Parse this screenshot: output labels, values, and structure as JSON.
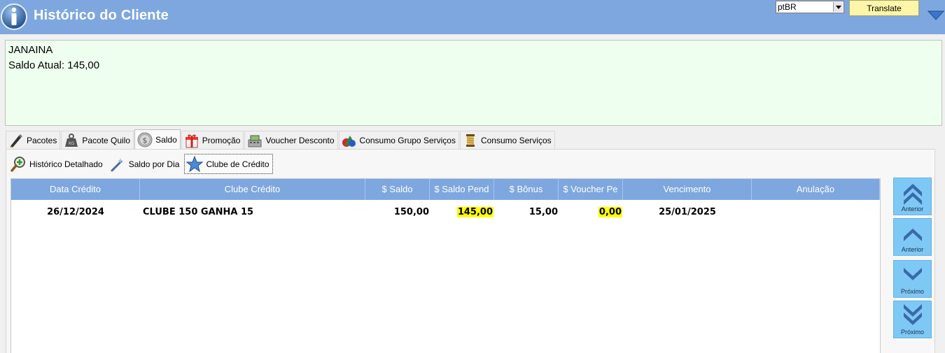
{
  "header": {
    "title": "Histórico do Cliente",
    "language": "ptBR",
    "translate_label": "Translate"
  },
  "client": {
    "name": "JANAINA",
    "balance_line": "Saldo Atual: 145,00"
  },
  "tabs": [
    {
      "label": "Pacotes",
      "icon": "pen-icon"
    },
    {
      "label": "Pacote Quilo",
      "icon": "weight-icon"
    },
    {
      "label": "Saldo",
      "icon": "coin-icon"
    },
    {
      "label": "Promoção",
      "icon": "gift-icon"
    },
    {
      "label": "Voucher Desconto",
      "icon": "cash-register-icon"
    },
    {
      "label": "Consumo Grupo Serviços",
      "icon": "shapes-icon"
    },
    {
      "label": "Consumo Serviços",
      "icon": "thread-spool-icon"
    }
  ],
  "active_tab": "Saldo",
  "subtabs": [
    {
      "label": "Histórico Detalhado",
      "icon": "magnifier-plus-icon"
    },
    {
      "label": "Saldo por Dia",
      "icon": "magic-wand-icon"
    },
    {
      "label": "Clube de Crédito",
      "icon": "star-icon"
    }
  ],
  "active_subtab": "Clube de Crédito",
  "grid": {
    "columns": [
      "Data Crédito",
      "Clube Crédito",
      "$ Saldo",
      "$ Saldo Pend",
      "$ Bônus",
      "$ Voucher Pe",
      "Vencimento",
      "Anulação"
    ],
    "rows": [
      {
        "data_credito": "26/12/2024",
        "clube_credito": "CLUBE 150 GANHA 15",
        "saldo": "150,00",
        "saldo_pend": "145,00",
        "bonus": "15,00",
        "voucher_pe": "0,00",
        "vencimento": "25/01/2025",
        "anulacao": ""
      }
    ]
  },
  "nav": {
    "first_label": "Anterior",
    "prev_label": "Anterior",
    "next_label": "Próximo",
    "last_label": "Próximo"
  },
  "colors": {
    "header_blue": "#7ea7e0",
    "client_box_green": "#efffef",
    "highlight_yellow": "#ffff00",
    "nav_button_blue": "#7ec8f5"
  }
}
